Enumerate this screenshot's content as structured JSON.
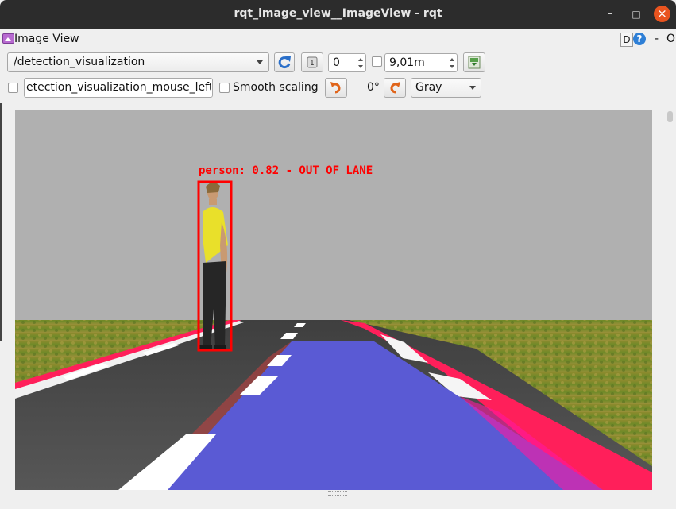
{
  "window": {
    "title": "rqt_image_view__ImageView - rqt",
    "minimize_glyph": "–",
    "maximize_glyph": "□",
    "close_glyph": "×"
  },
  "panel": {
    "title": "Image View",
    "dock_label": "D",
    "help_label": "?",
    "close_label": "-",
    "float_label": "O"
  },
  "toolbar": {
    "topic": "/detection_visualization",
    "frame_value": "0",
    "range_value": "9,01m",
    "dynamic_range_checked": false,
    "mouse_topic": "etection_visualization_mouse_left",
    "mouse_checked": false,
    "smooth_label": "Smooth scaling",
    "smooth_checked": false,
    "rotation": "0°",
    "color_scheme": "Gray"
  },
  "image": {
    "detection_label": "person: 0.82 - OUT OF LANE",
    "detection_color": "#ff0000",
    "lane_color": "#5050d8",
    "curb_color": "#ff1f5a",
    "sky_color": "#b0b0b0"
  }
}
